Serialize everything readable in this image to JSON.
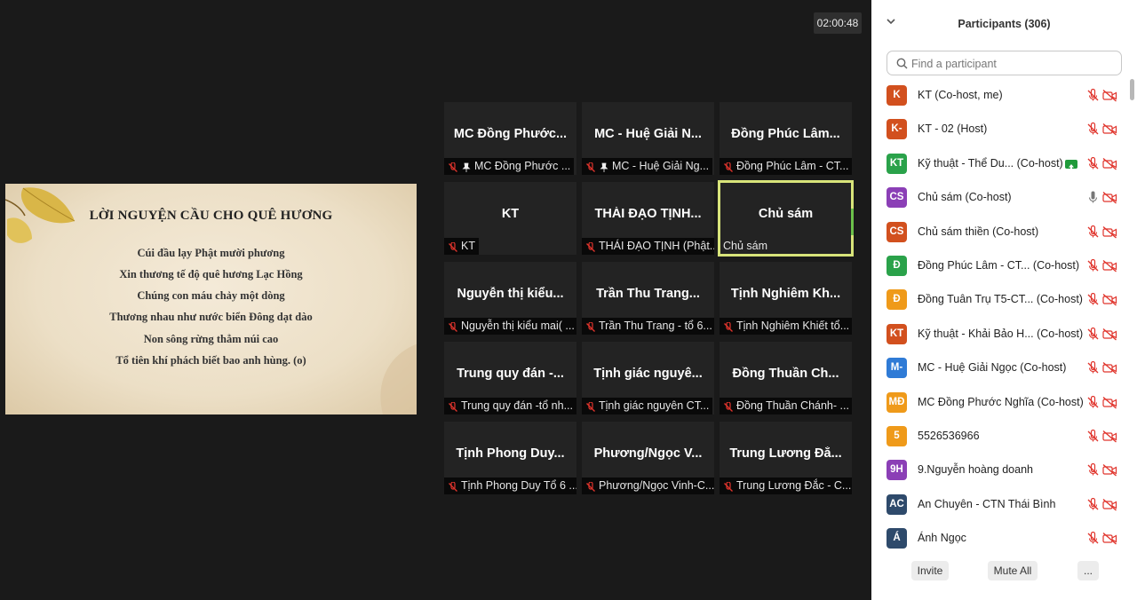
{
  "meeting": {
    "timer": "02:00:48",
    "shared_slide": {
      "title": "LỜI NGUYỆN CẦU CHO QUÊ HƯƠNG",
      "verses": [
        "Cúi đầu lạy Phật mười phương",
        "Xin thương tế độ quê hương Lạc Hồng",
        "Chúng con máu chảy một dòng",
        "Thương nhau như nước biển Đông dạt dào",
        "Non sông rừng thẳm núi cao",
        "Tổ tiên khí phách biết bao anh hùng. (o)"
      ]
    },
    "tiles": [
      {
        "name": "MC Đồng Phước...",
        "label": "MC Đồng Phước ...",
        "muted": true,
        "pinned": true,
        "active": false
      },
      {
        "name": "MC - Huệ Giải N...",
        "label": "MC - Huệ Giải Ng...",
        "muted": true,
        "pinned": true,
        "active": false
      },
      {
        "name": "Đồng Phúc Lâm...",
        "label": "Đồng Phúc Lâm - CT...",
        "muted": true,
        "pinned": false,
        "active": false
      },
      {
        "name": "KT",
        "label": "KT",
        "muted": true,
        "pinned": false,
        "active": false
      },
      {
        "name": "THÁI ĐẠO TỊNH...",
        "label": "THÁI ĐẠO TỊNH (Phật...",
        "muted": true,
        "pinned": false,
        "active": false
      },
      {
        "name": "Chủ sám",
        "label": "Chủ sám",
        "muted": false,
        "pinned": false,
        "active": true
      },
      {
        "name": "Nguyễn thị kiểu...",
        "label": "Nguyễn thị kiểu mai( ...",
        "muted": true,
        "pinned": false,
        "active": false
      },
      {
        "name": "Trần Thu Trang...",
        "label": "Trần Thu Trang - tổ 6...",
        "muted": true,
        "pinned": false,
        "active": false
      },
      {
        "name": "Tịnh Nghiêm Kh...",
        "label": "Tịnh Nghiêm Khiết tổ...",
        "muted": true,
        "pinned": false,
        "active": false
      },
      {
        "name": "Trung quy đán -...",
        "label": "Trung quy đán -tổ nh...",
        "muted": true,
        "pinned": false,
        "active": false
      },
      {
        "name": "Tịnh giác nguyê...",
        "label": "Tịnh giác nguyên CT...",
        "muted": true,
        "pinned": false,
        "active": false
      },
      {
        "name": "Đồng Thuần Ch...",
        "label": "Đồng Thuần Chánh- ...",
        "muted": true,
        "pinned": false,
        "active": false
      },
      {
        "name": "Tịnh Phong Duy...",
        "label": "Tịnh Phong Duy Tổ 6 ...",
        "muted": true,
        "pinned": false,
        "active": false
      },
      {
        "name": "Phương/Ngọc V...",
        "label": "Phương/Ngọc Vinh-C...",
        "muted": true,
        "pinned": false,
        "active": false
      },
      {
        "name": "Trung Lương Đắ...",
        "label": "Trung Lương Đắc - C...",
        "muted": true,
        "pinned": false,
        "active": false
      }
    ]
  },
  "panel": {
    "title": "Participants (306)",
    "search_placeholder": "Find a participant",
    "participants": [
      {
        "initials": "K",
        "color": "#d2501e",
        "name": "KT (Co-host, me)",
        "mic": "muted",
        "share": false
      },
      {
        "initials": "K-",
        "color": "#d2501e",
        "name": "KT - 02 (Host)",
        "mic": "muted",
        "share": false
      },
      {
        "initials": "KT",
        "color": "#2aa24a",
        "name": "Kỹ thuật - Thể Du...  (Co-host)",
        "mic": "muted",
        "share": true
      },
      {
        "initials": "CS",
        "color": "#8b3fb6",
        "name": "Chủ sám (Co-host)",
        "mic": "on",
        "share": false
      },
      {
        "initials": "CS",
        "color": "#d2501e",
        "name": "Chủ sám thiền (Co-host)",
        "mic": "muted",
        "share": false
      },
      {
        "initials": "Đ",
        "color": "#2aa24a",
        "name": "Đồng Phúc Lâm -  CT...  (Co-host)",
        "mic": "muted",
        "share": false
      },
      {
        "initials": "Đ",
        "color": "#ef9a1a",
        "name": "Đồng Tuân Trụ T5-CT...  (Co-host)",
        "mic": "muted",
        "share": false
      },
      {
        "initials": "KT",
        "color": "#d2501e",
        "name": "Kỹ thuật - Khải Bảo H...  (Co-host)",
        "mic": "muted",
        "share": false
      },
      {
        "initials": "M-",
        "color": "#2f7bd6",
        "name": "MC - Huệ Giải Ngọc (Co-host)",
        "mic": "muted",
        "share": false
      },
      {
        "initials": "MĐ",
        "color": "#ef9a1a",
        "name": "MC Đồng Phước Nghĩa (Co-host)",
        "mic": "muted",
        "share": false
      },
      {
        "initials": "5",
        "color": "#ef9a1a",
        "name": "5526536966",
        "mic": "muted",
        "share": false
      },
      {
        "initials": "9H",
        "color": "#8b3fb6",
        "name": "9.Nguyễn hoàng doanh",
        "mic": "muted",
        "share": false
      },
      {
        "initials": "AC",
        "color": "#2e4a6b",
        "name": "An Chuyên - CTN Thái Bình",
        "mic": "muted",
        "share": false
      },
      {
        "initials": "Á",
        "color": "#2e4a6b",
        "name": "Ánh Ngọc",
        "mic": "muted",
        "share": false
      }
    ],
    "footer": {
      "invite": "Invite",
      "mute_all": "Mute All",
      "more": "..."
    }
  }
}
